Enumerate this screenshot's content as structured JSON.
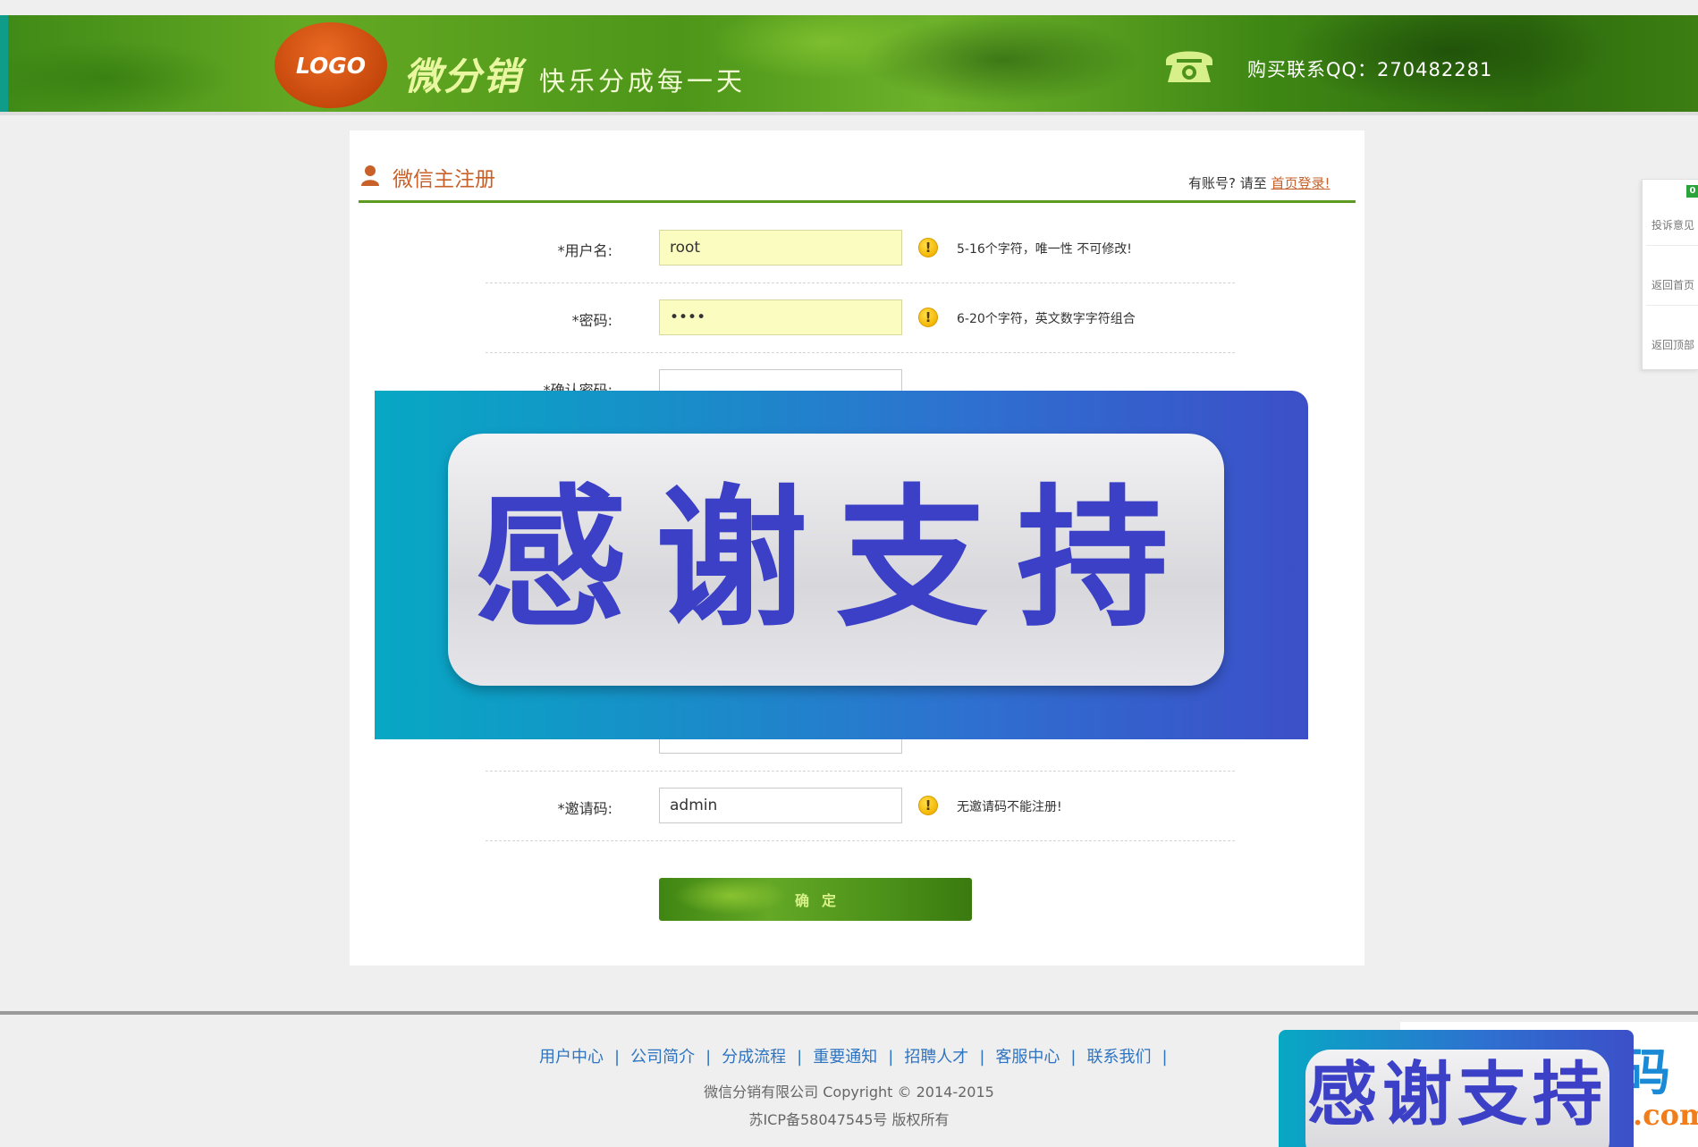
{
  "header": {
    "logo": "LOGO",
    "brand": "微分销",
    "slogan": "快乐分成每一天",
    "contact": "购买联系QQ：270482281"
  },
  "panel": {
    "title": "微信主注册",
    "login_prompt": "有账号? 请至",
    "login_link": "首页登录!"
  },
  "form": {
    "username": {
      "label": "*用户名:",
      "value": "root",
      "hint": "5-16个字符，唯一性 不可修改!"
    },
    "password": {
      "label": "*密码:",
      "value": "••••",
      "hint": "6-20个字符，英文数字字符组合"
    },
    "confirm_password": {
      "label": "*确认密码:",
      "value": ""
    },
    "payment": {
      "value": ""
    },
    "invite": {
      "label": "*邀请码:",
      "value": "admin",
      "hint": "无邀请码不能注册!"
    },
    "submit_label": "确定",
    "warn_symbol": "!"
  },
  "overlay": {
    "text": "感谢支持"
  },
  "sidebar": {
    "badge": "0",
    "items": [
      {
        "label": "投诉意见"
      },
      {
        "label": "返回首页"
      },
      {
        "label": "返回顶部"
      }
    ]
  },
  "footer": {
    "nav": [
      {
        "label": "用户中心"
      },
      {
        "label": "公司简介"
      },
      {
        "label": "分成流程"
      },
      {
        "label": "重要通知"
      },
      {
        "label": "招聘人才"
      },
      {
        "label": "客服中心"
      },
      {
        "label": "联系我们"
      }
    ],
    "separator": "|",
    "copyright": "微信分销有限公司   Copyright © 2014-2015",
    "icp": "苏ICP备58047545号 版权所有"
  },
  "corner": {
    "badge_text": "感谢支持",
    "ma": "码",
    "com": ".com"
  },
  "colors": {
    "accent_green": "#5d9b20",
    "title_orange": "#c8602a",
    "link_blue": "#2f74c0",
    "overlay_text": "#3c40c6"
  },
  "icons": [
    "phone-icon",
    "user-icon",
    "warning-icon"
  ]
}
